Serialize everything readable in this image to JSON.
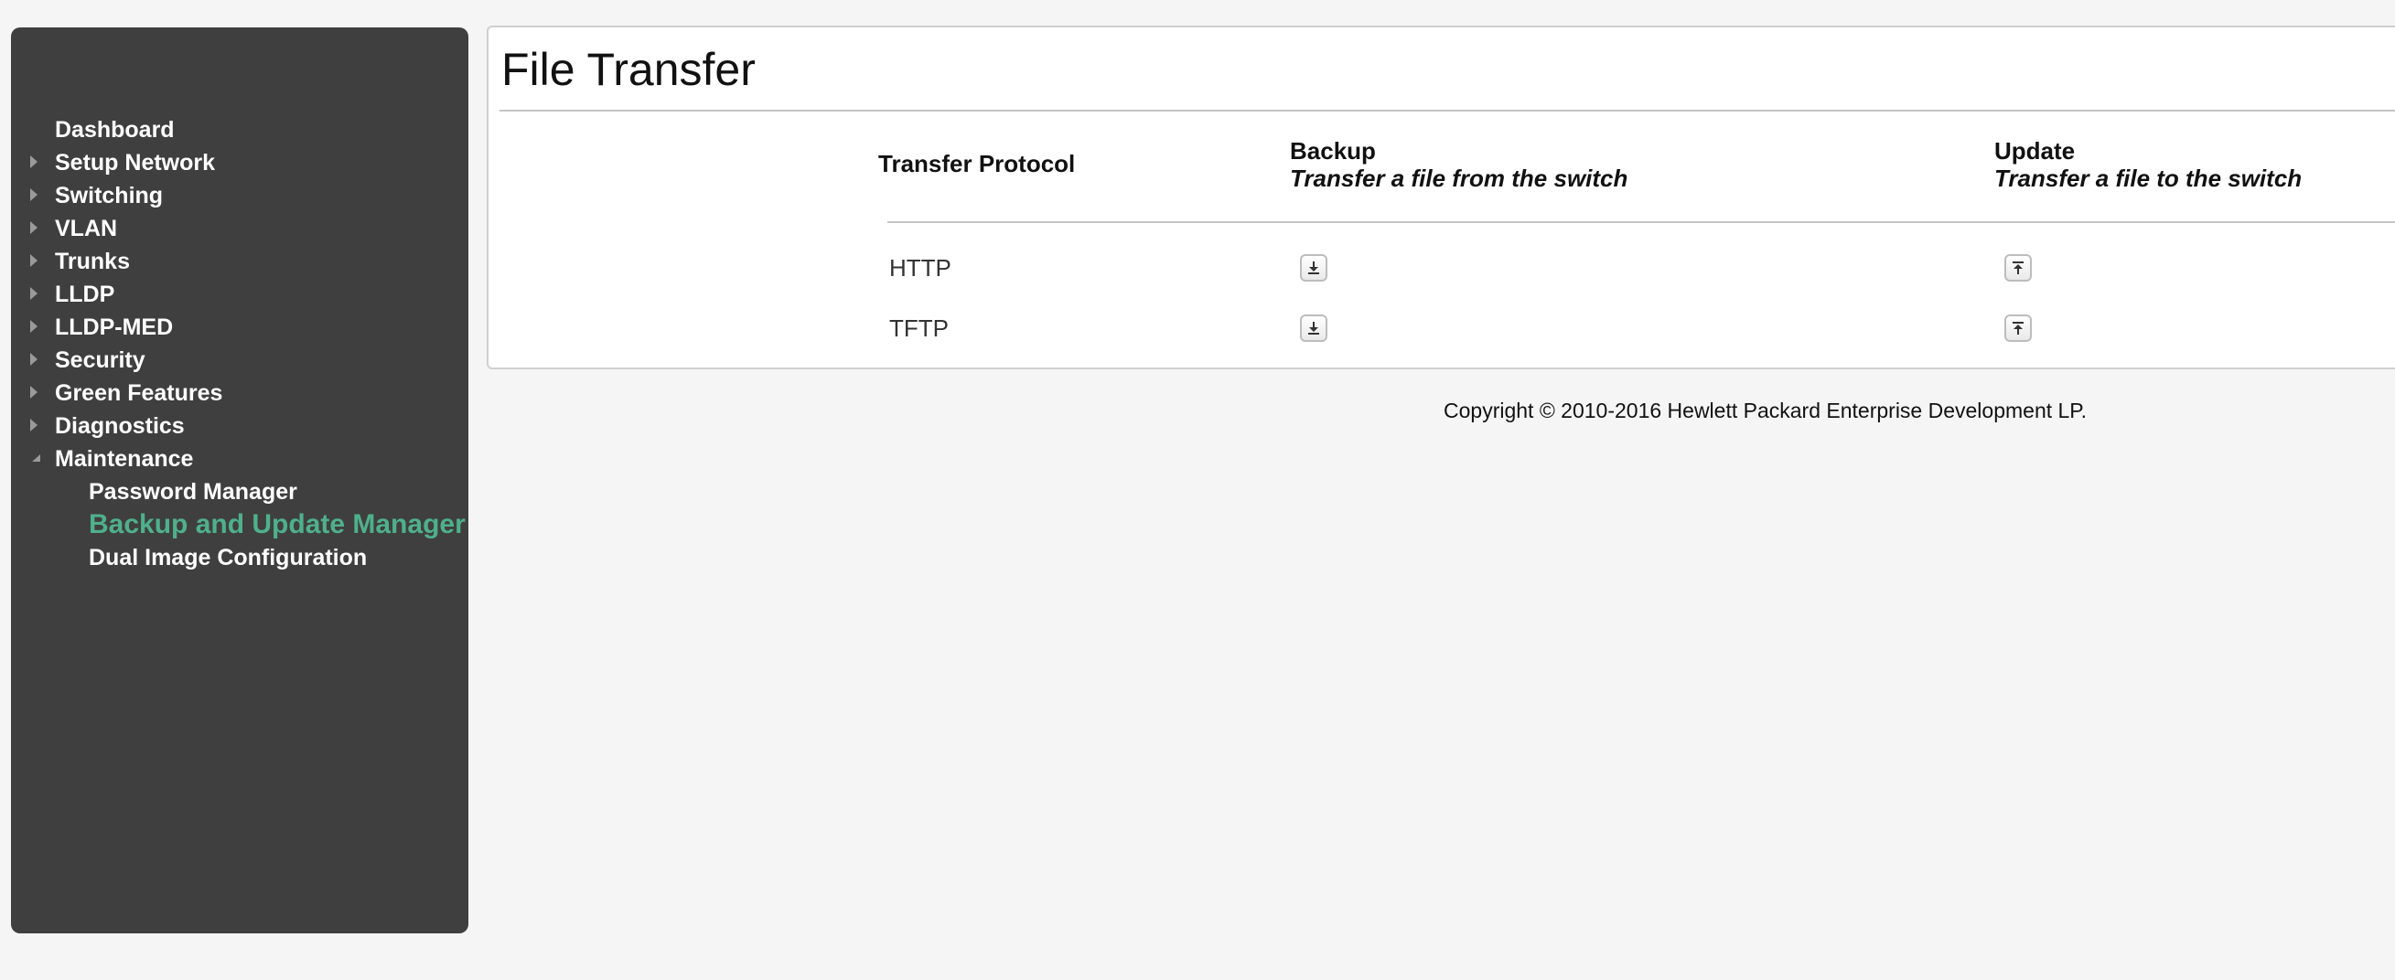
{
  "sidebar": {
    "items": [
      {
        "label": "Dashboard",
        "arrow": "none"
      },
      {
        "label": "Setup Network",
        "arrow": "right"
      },
      {
        "label": "Switching",
        "arrow": "right"
      },
      {
        "label": "VLAN",
        "arrow": "right"
      },
      {
        "label": "Trunks",
        "arrow": "right"
      },
      {
        "label": "LLDP",
        "arrow": "right"
      },
      {
        "label": "LLDP-MED",
        "arrow": "right"
      },
      {
        "label": "Security",
        "arrow": "right"
      },
      {
        "label": "Green Features",
        "arrow": "right"
      },
      {
        "label": "Diagnostics",
        "arrow": "right"
      },
      {
        "label": "Maintenance",
        "arrow": "down"
      }
    ],
    "subitems": [
      {
        "label": "Password Manager",
        "active": false
      },
      {
        "label": "Backup and Update Manager",
        "active": true
      },
      {
        "label": "Dual Image Configuration",
        "active": false
      }
    ],
    "active_color": "#4fb08c",
    "background_color": "#3f3f3f"
  },
  "page": {
    "title": "File Transfer"
  },
  "table": {
    "col_protocol": "Transfer Protocol",
    "col_backup": "Backup",
    "col_backup_sub": "Transfer a file from the switch",
    "col_update": "Update",
    "col_update_sub": "Transfer a file to the switch",
    "rows": [
      {
        "protocol": "HTTP",
        "backup_icon": "download-icon",
        "update_icon": "upload-icon"
      },
      {
        "protocol": "TFTP",
        "backup_icon": "download-icon",
        "update_icon": "upload-icon"
      }
    ]
  },
  "footer": {
    "copyright": "Copyright © 2010-2016 Hewlett Packard Enterprise Development LP."
  }
}
